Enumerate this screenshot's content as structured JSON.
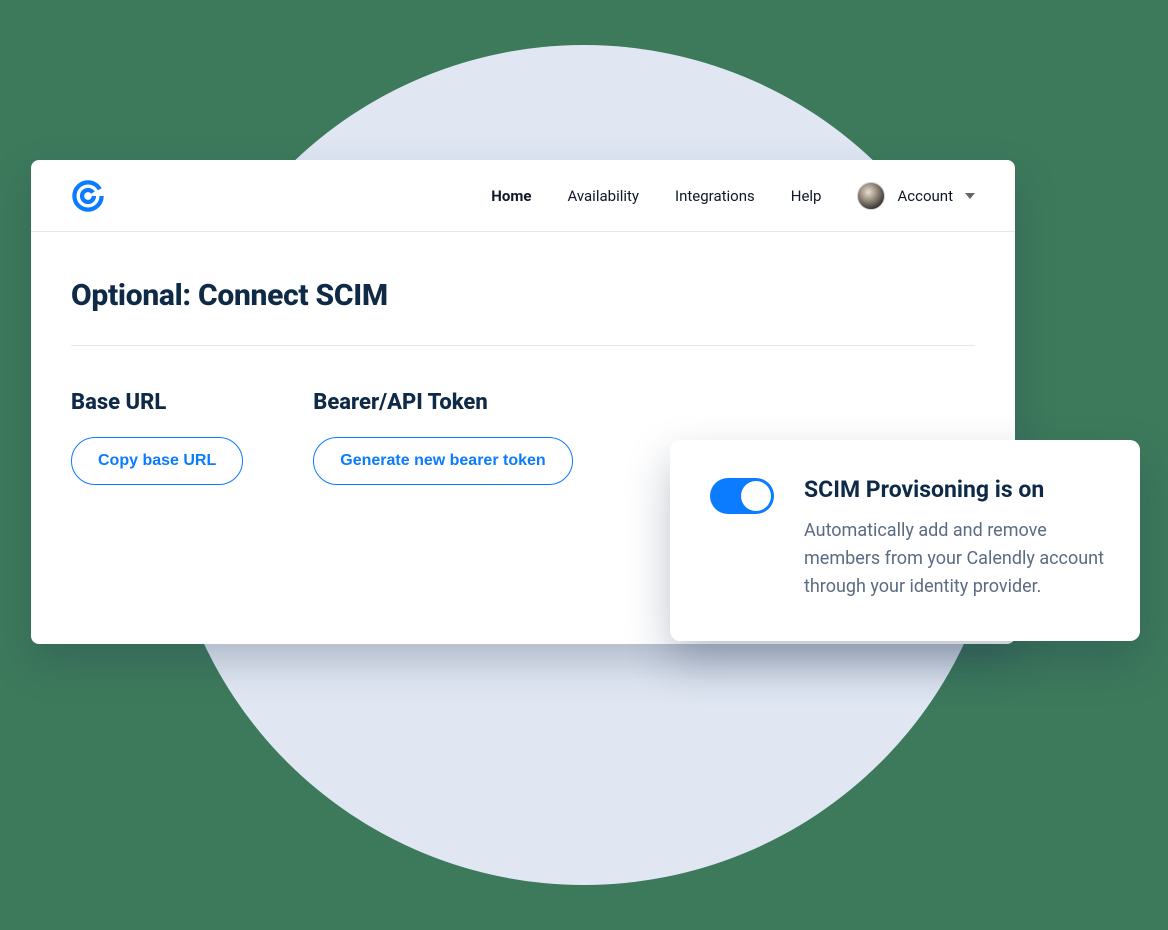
{
  "nav": {
    "home": "Home",
    "availability": "Availability",
    "integrations": "Integrations",
    "help": "Help",
    "account": "Account"
  },
  "page": {
    "title": "Optional: Connect SCIM"
  },
  "sections": {
    "base_url": {
      "heading": "Base URL",
      "button": "Copy base URL"
    },
    "bearer": {
      "heading": "Bearer/API Token",
      "button": "Generate new bearer token"
    }
  },
  "popup": {
    "title": "SCIM Provisoning is on",
    "description": "Automatically add and remove members from your Calendly account through your identity provider."
  }
}
